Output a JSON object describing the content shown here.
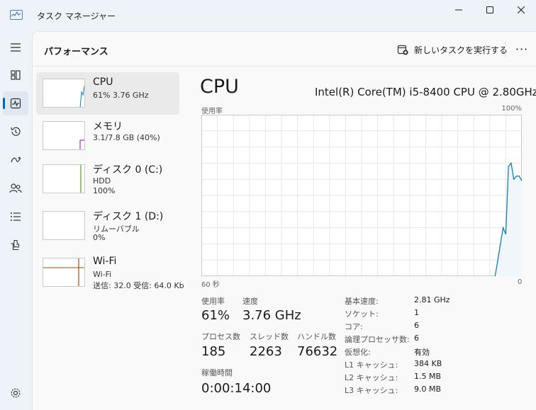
{
  "window": {
    "title": "タスク マネージャー"
  },
  "rail": {
    "items": [
      {
        "icon": "hamburger-menu-icon"
      },
      {
        "icon": "processes-icon"
      },
      {
        "icon": "performance-icon",
        "active": true
      },
      {
        "icon": "app-history-icon"
      },
      {
        "icon": "startup-apps-icon"
      },
      {
        "icon": "users-icon"
      },
      {
        "icon": "details-icon"
      },
      {
        "icon": "services-icon"
      },
      {
        "icon": "settings-icon"
      }
    ]
  },
  "header": {
    "title": "パフォーマンス",
    "run_task_label": "新しいタスクを実行する",
    "more_label": "···"
  },
  "resources": [
    {
      "name": "CPU",
      "line1": "61%  3.76 GHz",
      "line2": "",
      "color": "#117dbb",
      "active": true
    },
    {
      "name": "メモリ",
      "line1": "3.1/7.8 GB (40%)",
      "line2": "",
      "color": "#8b12ae"
    },
    {
      "name": "ディスク 0 (C:)",
      "line1": "HDD",
      "line2": "100%",
      "color": "#4da60c"
    },
    {
      "name": "ディスク 1 (D:)",
      "line1": "リムーバブル",
      "line2": "0%",
      "color": "#4da60c"
    },
    {
      "name": "Wi-Fi",
      "line1": "Wi-Fi",
      "line2": "送信: 32.0  受信: 64.0 Kb",
      "color": "#a74f01"
    }
  ],
  "detail": {
    "title": "CPU",
    "model": "Intel(R) Core(TM) i5-8400 CPU @ 2.80GHz",
    "graph_label": "使用率",
    "graph_max": "100%",
    "axis_left": "60 秒",
    "axis_right": "0",
    "usage_label": "使用率",
    "usage_value": "61%",
    "speed_label": "速度",
    "speed_value": "3.76 GHz",
    "processes_label": "プロセス数",
    "processes_value": "185",
    "threads_label": "スレッド数",
    "threads_value": "2263",
    "handles_label": "ハンドル数",
    "handles_value": "76632",
    "uptime_label": "稼働時間",
    "uptime_value": "0:00:14:00",
    "specs": [
      {
        "k": "基本速度:",
        "v": "2.81 GHz"
      },
      {
        "k": "ソケット:",
        "v": "1"
      },
      {
        "k": "コア:",
        "v": "6"
      },
      {
        "k": "論理プロセッサ数:",
        "v": "6"
      },
      {
        "k": "仮想化:",
        "v": "有効"
      },
      {
        "k": "L1 キャッシュ:",
        "v": "384 KB"
      },
      {
        "k": "L2 キャッシュ:",
        "v": "1.5 MB"
      },
      {
        "k": "L3 キャッシュ:",
        "v": "9.0 MB"
      }
    ]
  },
  "chart_data": {
    "type": "area",
    "x": [
      60,
      5,
      3.5,
      3,
      2.5,
      2,
      1.5,
      1,
      0.5,
      0
    ],
    "values": [
      0,
      0,
      30,
      26,
      68,
      70,
      60,
      62,
      62,
      59
    ],
    "ylim": [
      0,
      100
    ],
    "xlabel": "",
    "ylabel": "使用率",
    "grid": true,
    "color": "#117dbb",
    "fill": "#f1f6fa"
  }
}
